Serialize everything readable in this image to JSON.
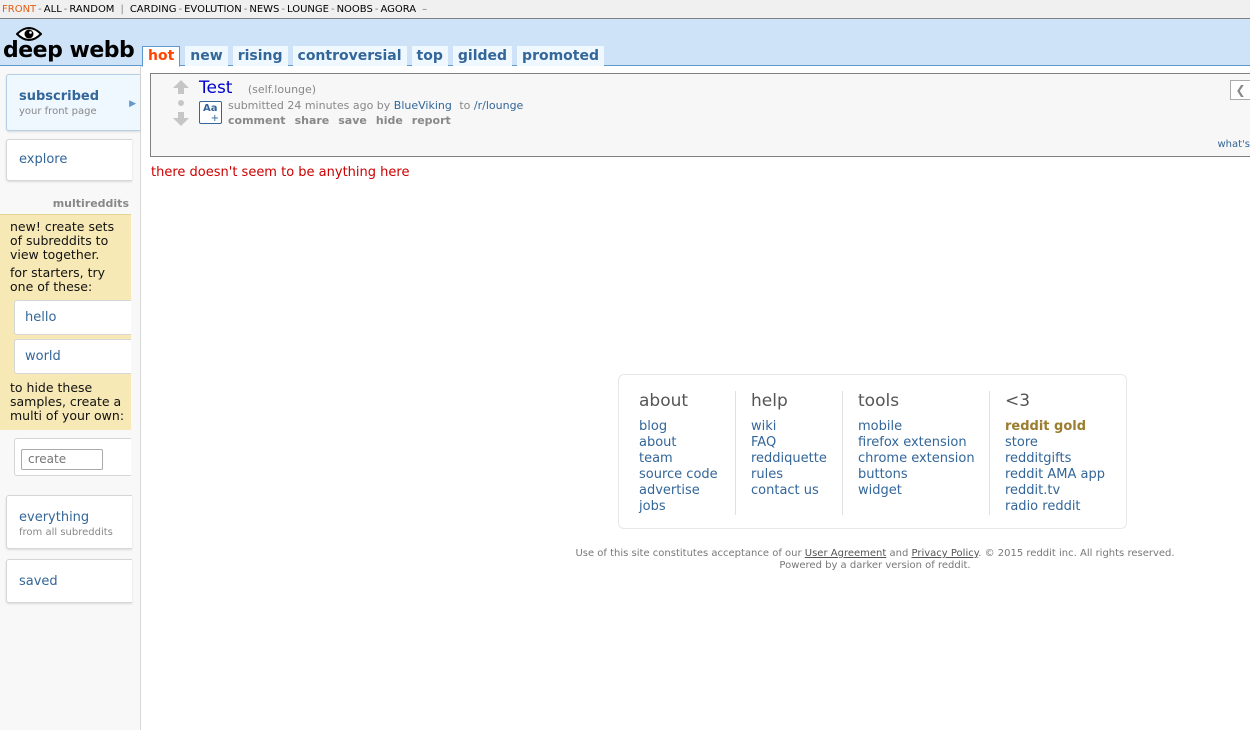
{
  "sr_bar": {
    "front": "FRONT",
    "all": "ALL",
    "random": "RANDOM",
    "subreddits": [
      "CARDING",
      "EVOLUTION",
      "NEWS",
      "LOUNGE",
      "NOOBS",
      "AGORA"
    ],
    "more": "–"
  },
  "header": {
    "logo_text": "deep webb",
    "tabs": [
      "hot",
      "new",
      "rising",
      "controversial",
      "top",
      "gilded",
      "promoted"
    ],
    "selected_tab": "hot"
  },
  "sidebar": {
    "subscribed": {
      "label": "subscribed",
      "sub": "your front page"
    },
    "explore": {
      "label": "explore"
    },
    "multireddits_title": "multireddits",
    "multi_intro": "new! create sets of subreddits to view together.",
    "multi_starters": "for starters, try one of these:",
    "samples": [
      "hello",
      "world"
    ],
    "multi_hide": "to hide these samples, create a multi of your own:",
    "create_placeholder": "create",
    "everything": {
      "label": "everything",
      "sub": "from all subreddits"
    },
    "saved": {
      "label": "saved"
    }
  },
  "post": {
    "title": "Test",
    "domain": "(self.lounge)",
    "thumb_label": "Aa",
    "thumb_plus": "+",
    "submitted_prefix": "submitted 24 minutes ago by",
    "author": "BlueViking",
    "to": "to",
    "subreddit": "/r/lounge",
    "buttons": [
      "comment",
      "share",
      "save",
      "hide",
      "report"
    ],
    "collapse": "❮",
    "whats_this": "what's"
  },
  "empty_message": "there doesn't seem to be anything here",
  "footer": {
    "columns": [
      {
        "title": "about",
        "links": [
          "blog",
          "about",
          "team",
          "source code",
          "advertise",
          "jobs"
        ]
      },
      {
        "title": "help",
        "links": [
          "wiki",
          "FAQ",
          "reddiquette",
          "rules",
          "contact us"
        ]
      },
      {
        "title": "tools",
        "links": [
          "mobile",
          "firefox extension",
          "chrome extension",
          "buttons",
          "widget"
        ]
      },
      {
        "title": "<3",
        "links": [
          "reddit gold",
          "store",
          "redditgifts",
          "reddit AMA app",
          "reddit.tv",
          "radio reddit"
        ]
      }
    ],
    "legal_prefix": "Use of this site constitutes acceptance of our",
    "user_agreement": "User Agreement",
    "and": "and",
    "privacy_policy": "Privacy Policy",
    "legal_suffix": ". © 2015 reddit inc. All rights reserved.",
    "powered_by": "Powered by a darker version of reddit."
  }
}
